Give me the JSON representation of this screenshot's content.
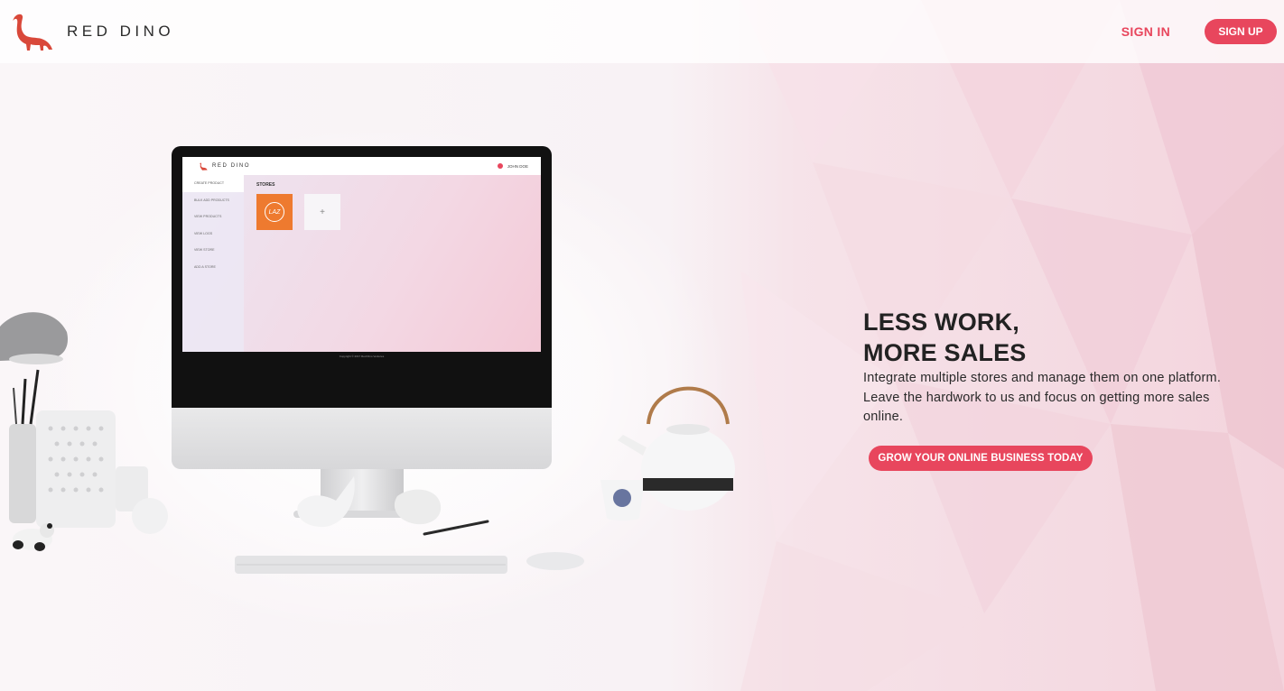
{
  "header": {
    "logo_text": "RED DINO",
    "sign_in_label": "SIGN IN",
    "sign_up_label": "SIGN UP"
  },
  "hero": {
    "headline_line1": "LESS WORK,",
    "headline_line2": "MORE SALES",
    "description": "Integrate multiple stores and manage them on one platform. Leave the hardwork to us and focus on getting more sales online.",
    "cta_label": "GROW YOUR ONLINE BUSINESS TODAY"
  },
  "screen_mockup": {
    "logo_text": "RED DINO",
    "user_name": "JOHN DOE",
    "sidebar_items": [
      "CREATE PRODUCT",
      "BULK ADD PRODUCTS",
      "VIEW PRODUCTS",
      "VIEW LOGS",
      "VIEW STORE",
      "ADD A STORE"
    ],
    "section_title": "STORES",
    "store_badge": "LAZ",
    "add_symbol": "+",
    "footer_text": "Copyright © 2017 Red Dino Ventures"
  },
  "colors": {
    "accent": "#e8465d",
    "store_orange": "#ee7a2f"
  }
}
